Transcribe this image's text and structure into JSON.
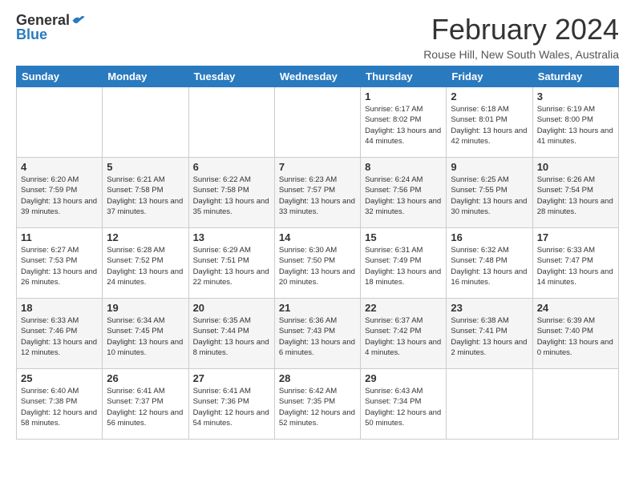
{
  "logo": {
    "general": "General",
    "blue": "Blue"
  },
  "title": {
    "month_year": "February 2024",
    "location": "Rouse Hill, New South Wales, Australia"
  },
  "weekdays": [
    "Sunday",
    "Monday",
    "Tuesday",
    "Wednesday",
    "Thursday",
    "Friday",
    "Saturday"
  ],
  "weeks": [
    [
      {
        "day": "",
        "info": ""
      },
      {
        "day": "",
        "info": ""
      },
      {
        "day": "",
        "info": ""
      },
      {
        "day": "",
        "info": ""
      },
      {
        "day": "1",
        "info": "Sunrise: 6:17 AM\nSunset: 8:02 PM\nDaylight: 13 hours\nand 44 minutes."
      },
      {
        "day": "2",
        "info": "Sunrise: 6:18 AM\nSunset: 8:01 PM\nDaylight: 13 hours\nand 42 minutes."
      },
      {
        "day": "3",
        "info": "Sunrise: 6:19 AM\nSunset: 8:00 PM\nDaylight: 13 hours\nand 41 minutes."
      }
    ],
    [
      {
        "day": "4",
        "info": "Sunrise: 6:20 AM\nSunset: 7:59 PM\nDaylight: 13 hours\nand 39 minutes."
      },
      {
        "day": "5",
        "info": "Sunrise: 6:21 AM\nSunset: 7:58 PM\nDaylight: 13 hours\nand 37 minutes."
      },
      {
        "day": "6",
        "info": "Sunrise: 6:22 AM\nSunset: 7:58 PM\nDaylight: 13 hours\nand 35 minutes."
      },
      {
        "day": "7",
        "info": "Sunrise: 6:23 AM\nSunset: 7:57 PM\nDaylight: 13 hours\nand 33 minutes."
      },
      {
        "day": "8",
        "info": "Sunrise: 6:24 AM\nSunset: 7:56 PM\nDaylight: 13 hours\nand 32 minutes."
      },
      {
        "day": "9",
        "info": "Sunrise: 6:25 AM\nSunset: 7:55 PM\nDaylight: 13 hours\nand 30 minutes."
      },
      {
        "day": "10",
        "info": "Sunrise: 6:26 AM\nSunset: 7:54 PM\nDaylight: 13 hours\nand 28 minutes."
      }
    ],
    [
      {
        "day": "11",
        "info": "Sunrise: 6:27 AM\nSunset: 7:53 PM\nDaylight: 13 hours\nand 26 minutes."
      },
      {
        "day": "12",
        "info": "Sunrise: 6:28 AM\nSunset: 7:52 PM\nDaylight: 13 hours\nand 24 minutes."
      },
      {
        "day": "13",
        "info": "Sunrise: 6:29 AM\nSunset: 7:51 PM\nDaylight: 13 hours\nand 22 minutes."
      },
      {
        "day": "14",
        "info": "Sunrise: 6:30 AM\nSunset: 7:50 PM\nDaylight: 13 hours\nand 20 minutes."
      },
      {
        "day": "15",
        "info": "Sunrise: 6:31 AM\nSunset: 7:49 PM\nDaylight: 13 hours\nand 18 minutes."
      },
      {
        "day": "16",
        "info": "Sunrise: 6:32 AM\nSunset: 7:48 PM\nDaylight: 13 hours\nand 16 minutes."
      },
      {
        "day": "17",
        "info": "Sunrise: 6:33 AM\nSunset: 7:47 PM\nDaylight: 13 hours\nand 14 minutes."
      }
    ],
    [
      {
        "day": "18",
        "info": "Sunrise: 6:33 AM\nSunset: 7:46 PM\nDaylight: 13 hours\nand 12 minutes."
      },
      {
        "day": "19",
        "info": "Sunrise: 6:34 AM\nSunset: 7:45 PM\nDaylight: 13 hours\nand 10 minutes."
      },
      {
        "day": "20",
        "info": "Sunrise: 6:35 AM\nSunset: 7:44 PM\nDaylight: 13 hours\nand 8 minutes."
      },
      {
        "day": "21",
        "info": "Sunrise: 6:36 AM\nSunset: 7:43 PM\nDaylight: 13 hours\nand 6 minutes."
      },
      {
        "day": "22",
        "info": "Sunrise: 6:37 AM\nSunset: 7:42 PM\nDaylight: 13 hours\nand 4 minutes."
      },
      {
        "day": "23",
        "info": "Sunrise: 6:38 AM\nSunset: 7:41 PM\nDaylight: 13 hours\nand 2 minutes."
      },
      {
        "day": "24",
        "info": "Sunrise: 6:39 AM\nSunset: 7:40 PM\nDaylight: 13 hours\nand 0 minutes."
      }
    ],
    [
      {
        "day": "25",
        "info": "Sunrise: 6:40 AM\nSunset: 7:38 PM\nDaylight: 12 hours\nand 58 minutes."
      },
      {
        "day": "26",
        "info": "Sunrise: 6:41 AM\nSunset: 7:37 PM\nDaylight: 12 hours\nand 56 minutes."
      },
      {
        "day": "27",
        "info": "Sunrise: 6:41 AM\nSunset: 7:36 PM\nDaylight: 12 hours\nand 54 minutes."
      },
      {
        "day": "28",
        "info": "Sunrise: 6:42 AM\nSunset: 7:35 PM\nDaylight: 12 hours\nand 52 minutes."
      },
      {
        "day": "29",
        "info": "Sunrise: 6:43 AM\nSunset: 7:34 PM\nDaylight: 12 hours\nand 50 minutes."
      },
      {
        "day": "",
        "info": ""
      },
      {
        "day": "",
        "info": ""
      }
    ]
  ]
}
